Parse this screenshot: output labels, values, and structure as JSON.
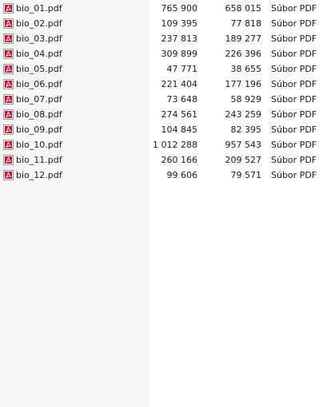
{
  "files": [
    {
      "name": "bio_01.pdf",
      "size": "765 900",
      "compressed": "658 015",
      "type": "Súbor PDF",
      "icon": "pdf-file-icon"
    },
    {
      "name": "bio_02.pdf",
      "size": "109 395",
      "compressed": "77 818",
      "type": "Súbor PDF",
      "icon": "pdf-file-icon"
    },
    {
      "name": "bio_03.pdf",
      "size": "237 813",
      "compressed": "189 277",
      "type": "Súbor PDF",
      "icon": "pdf-file-icon"
    },
    {
      "name": "bio_04.pdf",
      "size": "309 899",
      "compressed": "226 396",
      "type": "Súbor PDF",
      "icon": "pdf-file-icon"
    },
    {
      "name": "bio_05.pdf",
      "size": "47 771",
      "compressed": "38 655",
      "type": "Súbor PDF",
      "icon": "pdf-file-icon"
    },
    {
      "name": "bio_06.pdf",
      "size": "221 404",
      "compressed": "177 196",
      "type": "Súbor PDF",
      "icon": "pdf-file-icon"
    },
    {
      "name": "bio_07.pdf",
      "size": "73 648",
      "compressed": "58 929",
      "type": "Súbor PDF",
      "icon": "pdf-file-icon"
    },
    {
      "name": "bio_08.pdf",
      "size": "274 561",
      "compressed": "243 259",
      "type": "Súbor PDF",
      "icon": "pdf-file-icon"
    },
    {
      "name": "bio_09.pdf",
      "size": "104 845",
      "compressed": "82 395",
      "type": "Súbor PDF",
      "icon": "pdf-file-icon"
    },
    {
      "name": "bio_10.pdf",
      "size": "1 012 288",
      "compressed": "957 543",
      "type": "Súbor PDF",
      "icon": "pdf-file-icon"
    },
    {
      "name": "bio_11.pdf",
      "size": "260 166",
      "compressed": "209 527",
      "type": "Súbor PDF",
      "icon": "pdf-file-icon"
    },
    {
      "name": "bio_12.pdf",
      "size": "99 606",
      "compressed": "79 571",
      "type": "Súbor PDF",
      "icon": "pdf-file-icon"
    }
  ],
  "colors": {
    "pdf_icon_red": "#c8102e",
    "name_column_bg": "#f7f7f7",
    "text": "#1a1a1a"
  }
}
